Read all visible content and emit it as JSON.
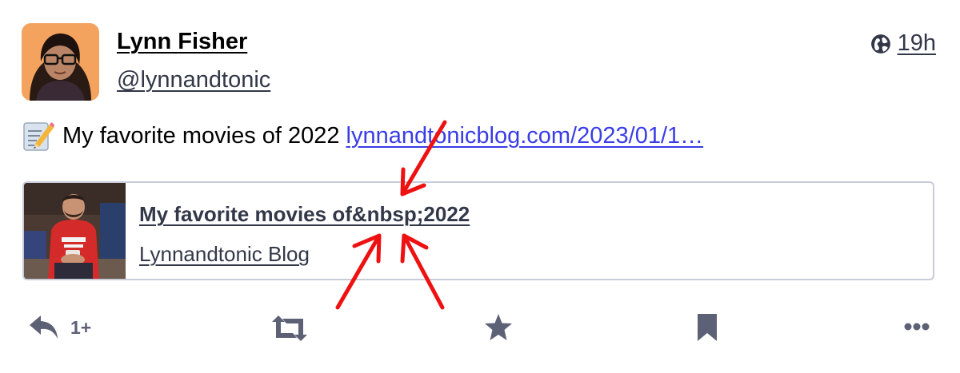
{
  "account": {
    "display_name": "Lynn Fisher",
    "handle": "@lynnandtonic"
  },
  "meta": {
    "visibility_icon": "globe-icon",
    "relative_time": "19h"
  },
  "status": {
    "emoji": "memo",
    "text": "My favorite movies of 2022",
    "link_text": "lynnandtonicblog.com/2023/01/1…"
  },
  "card": {
    "title": "My favorite movies of&nbsp;2022",
    "provider": "Lynnandtonic Blog"
  },
  "actions": {
    "reply_icon": "reply-icon",
    "reply_count": "1+",
    "boost_icon": "boost-icon",
    "favourite_icon": "star-icon",
    "bookmark_icon": "bookmark-icon",
    "more_icon": "more-icon"
  },
  "colors": {
    "text_primary": "#000000",
    "text_secondary": "#333849",
    "link": "#3a3de6",
    "icon": "#5d6176",
    "card_border": "#c8ccd9",
    "annotation": "#ee1111"
  }
}
